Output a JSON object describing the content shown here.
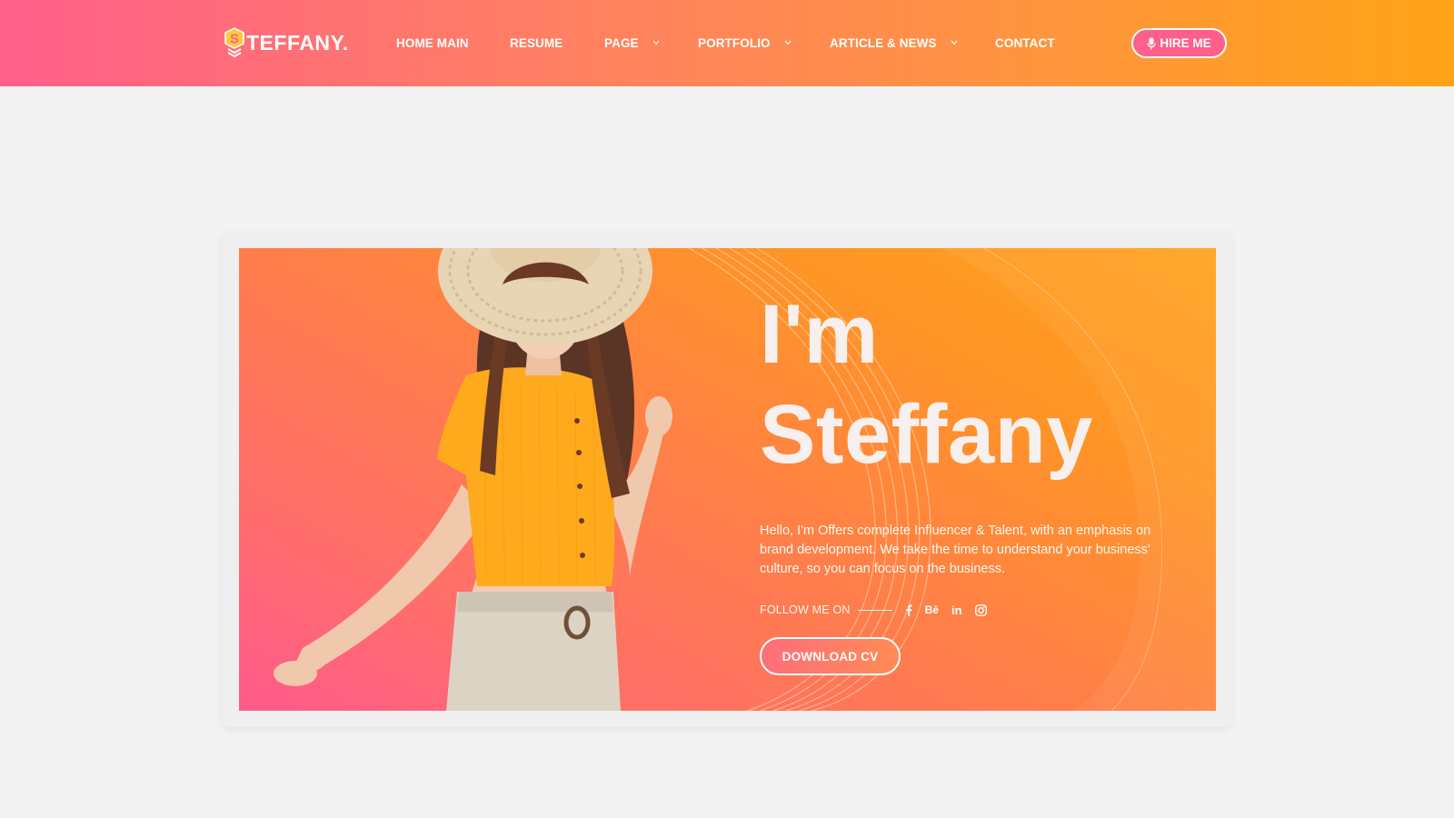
{
  "header": {
    "logo_text": "TEFFANY.",
    "logo_mark_letter": "S",
    "nav": [
      {
        "label": "HOME MAIN",
        "has_dropdown": false
      },
      {
        "label": "RESUME",
        "has_dropdown": false
      },
      {
        "label": "PAGE",
        "has_dropdown": true
      },
      {
        "label": "PORTFOLIO",
        "has_dropdown": true
      },
      {
        "label": "ARTICLE & NEWS",
        "has_dropdown": true
      },
      {
        "label": "CONTACT",
        "has_dropdown": false
      }
    ],
    "hire_label": "HIRE ME",
    "hire_icon": "microphone-icon"
  },
  "hero": {
    "title_line1": "I'm",
    "title_line2": "Steffany",
    "description": "Hello, I'm Offers complete Influencer & Talent, with an emphasis on brand development. We take the time to understand your business' culture, so you can focus on the business.",
    "follow_label": "FOLLOW ME ON",
    "social": [
      {
        "name": "facebook-icon",
        "glyph": "f"
      },
      {
        "name": "behance-icon",
        "glyph": "Bē"
      },
      {
        "name": "linkedin-icon",
        "glyph": "in"
      },
      {
        "name": "instagram-icon",
        "glyph": ""
      }
    ],
    "download_label": "DOWNLOAD CV"
  },
  "colors": {
    "brand_pink": "#ff5f8b",
    "brand_orange": "#ffa316",
    "page_background": "#f3f3f3",
    "title_text": "#f7f0ee"
  }
}
